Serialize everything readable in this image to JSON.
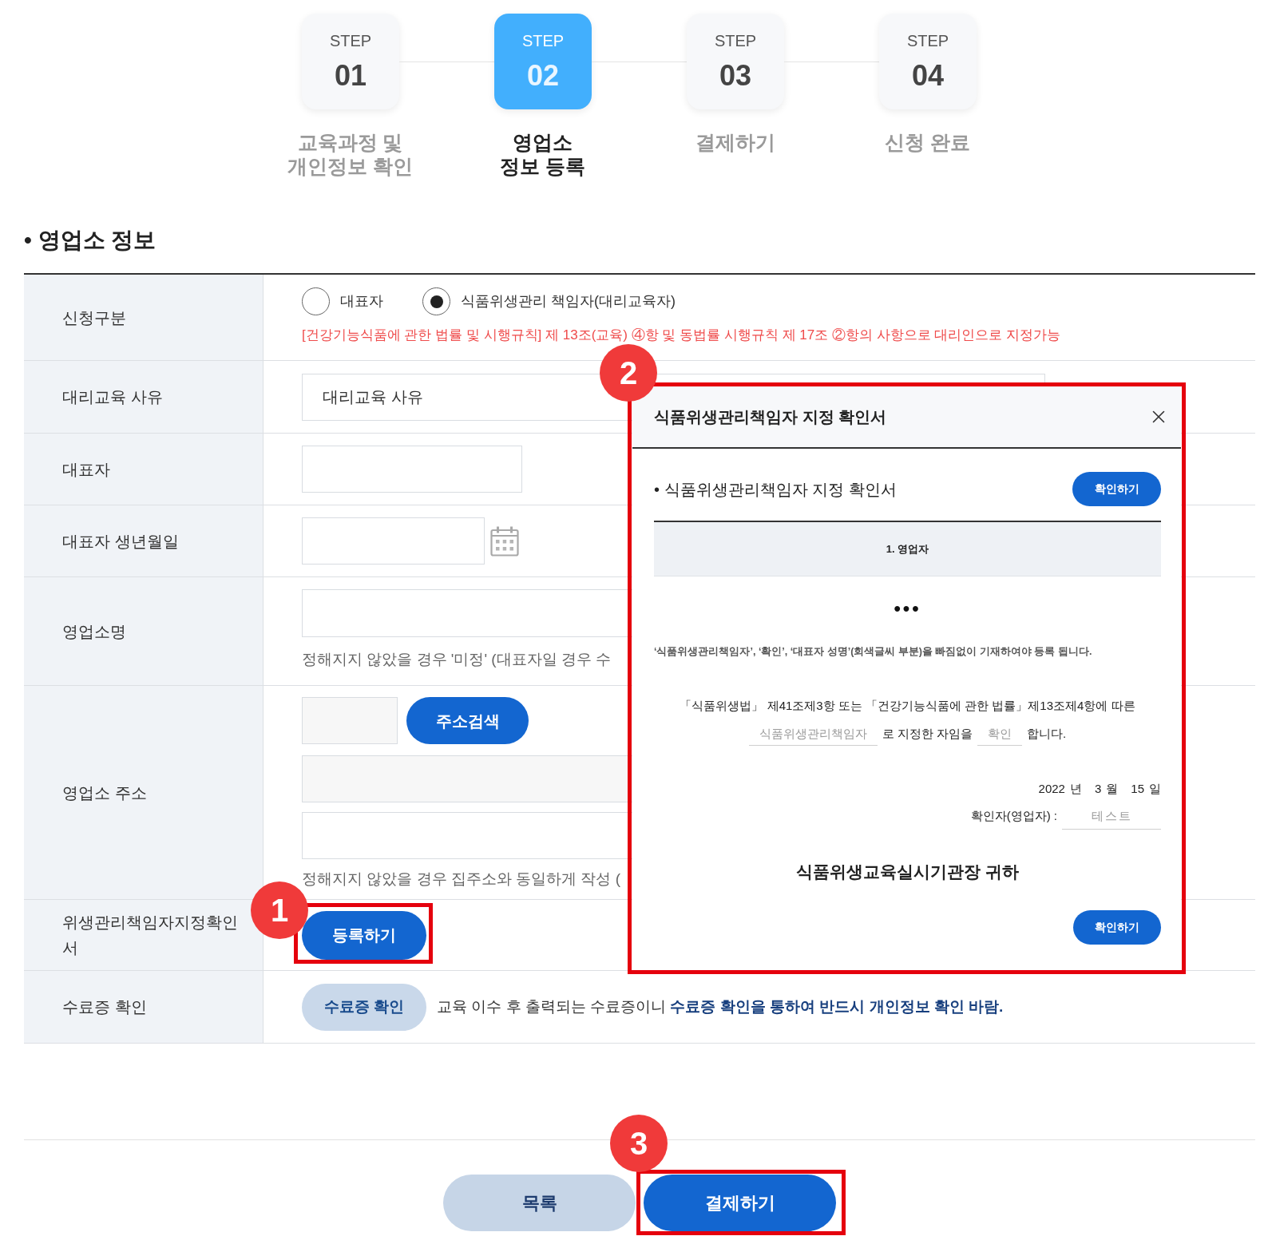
{
  "steps": [
    {
      "caption": "STEP",
      "number": "01",
      "title_lines": [
        "교육과정 및",
        "개인정보 확인"
      ],
      "selected": false
    },
    {
      "caption": "STEP",
      "number": "02",
      "title_lines": [
        "영업소",
        "정보 등록"
      ],
      "selected": true
    },
    {
      "caption": "STEP",
      "number": "03",
      "title_lines": [
        "결제하기"
      ],
      "selected": false
    },
    {
      "caption": "STEP",
      "number": "04",
      "title_lines": [
        "신청 완료"
      ],
      "selected": false
    }
  ],
  "section_title": "• 영업소 정보",
  "form": {
    "rows": [
      {
        "kind": "radio",
        "label": "신청구분",
        "options": [
          {
            "label": "대표자",
            "selected": false
          },
          {
            "label": "식품위생관리 책임자(대리교육자)",
            "selected": true
          }
        ],
        "notice": "[건강기능식품에 관한 법률 및 시행규칙] 제 13조(교육) ④항 및 동법률 시행규칙 제 17조 ②항의 사항으로 대리인으로 지정가능"
      },
      {
        "kind": "text",
        "label": "대리교육 사유",
        "value": "대리교육 사유"
      },
      {
        "kind": "short_text",
        "label": "대표자"
      },
      {
        "kind": "date",
        "label": "대표자 생년월일"
      },
      {
        "kind": "text_with_hint",
        "label": "영업소명",
        "hint": "정해지지 않았을 경우 '미정' (대표자일 경우 수"
      },
      {
        "kind": "address",
        "label": "영업소 주소",
        "search_button": "주소검색",
        "hint": "정해지지 않았을 경우 집주소와 동일하게 작성 ("
      },
      {
        "kind": "upload",
        "label": "위생관리책임자지정확인서",
        "button": "등록하기"
      },
      {
        "kind": "certificate",
        "label": "수료증 확인",
        "button": "수료증 확인",
        "note": "교육 이수 후 출력되는 수료증이니 **수료증 확인을 통하여 반드시 개인정보 확인 바람.**"
      }
    ]
  },
  "modal": {
    "title": "식품위생관리책임자 지정 확인서",
    "subtitle": "• 식품위생관리책임자 지정 확인서",
    "top_button": "확인하기",
    "table_header": "1. 영업자",
    "ellipsis": "•••",
    "note": "‘식품위생관리책임자’, ‘확인’, ‘대표자 성명’(회색글씨 부분)을 빠짐없이 기재하여야 등록 됩니다.",
    "statement_line": "「식품위생법」 제41조제3항 또는 「건강기능식품에 관한 법률」제13조제4항에 따른",
    "statement_parts": [
      {
        "kind": "field",
        "placeholder": "식품위생관리책임자"
      },
      {
        "kind": "text",
        "text": "로 지정한 자임을"
      },
      {
        "kind": "field",
        "placeholder": "확인"
      },
      {
        "kind": "text",
        "text": "합니다."
      }
    ],
    "date": [
      {
        "value": "2022",
        "unit": "년"
      },
      {
        "value": "3",
        "unit": "월"
      },
      {
        "value": "15",
        "unit": "일"
      }
    ],
    "signer": {
      "label": "확인자(영업자) :",
      "placeholder": "테스트"
    },
    "addressee": "식품위생교육실시기관장 귀하",
    "bottom_button": "확인하기"
  },
  "buttons": [
    {
      "kind": "secondary",
      "label": "목록"
    },
    {
      "kind": "primary",
      "label": "결제하기"
    }
  ],
  "callouts": [
    {
      "number": "1"
    },
    {
      "number": "2"
    },
    {
      "number": "3"
    }
  ]
}
